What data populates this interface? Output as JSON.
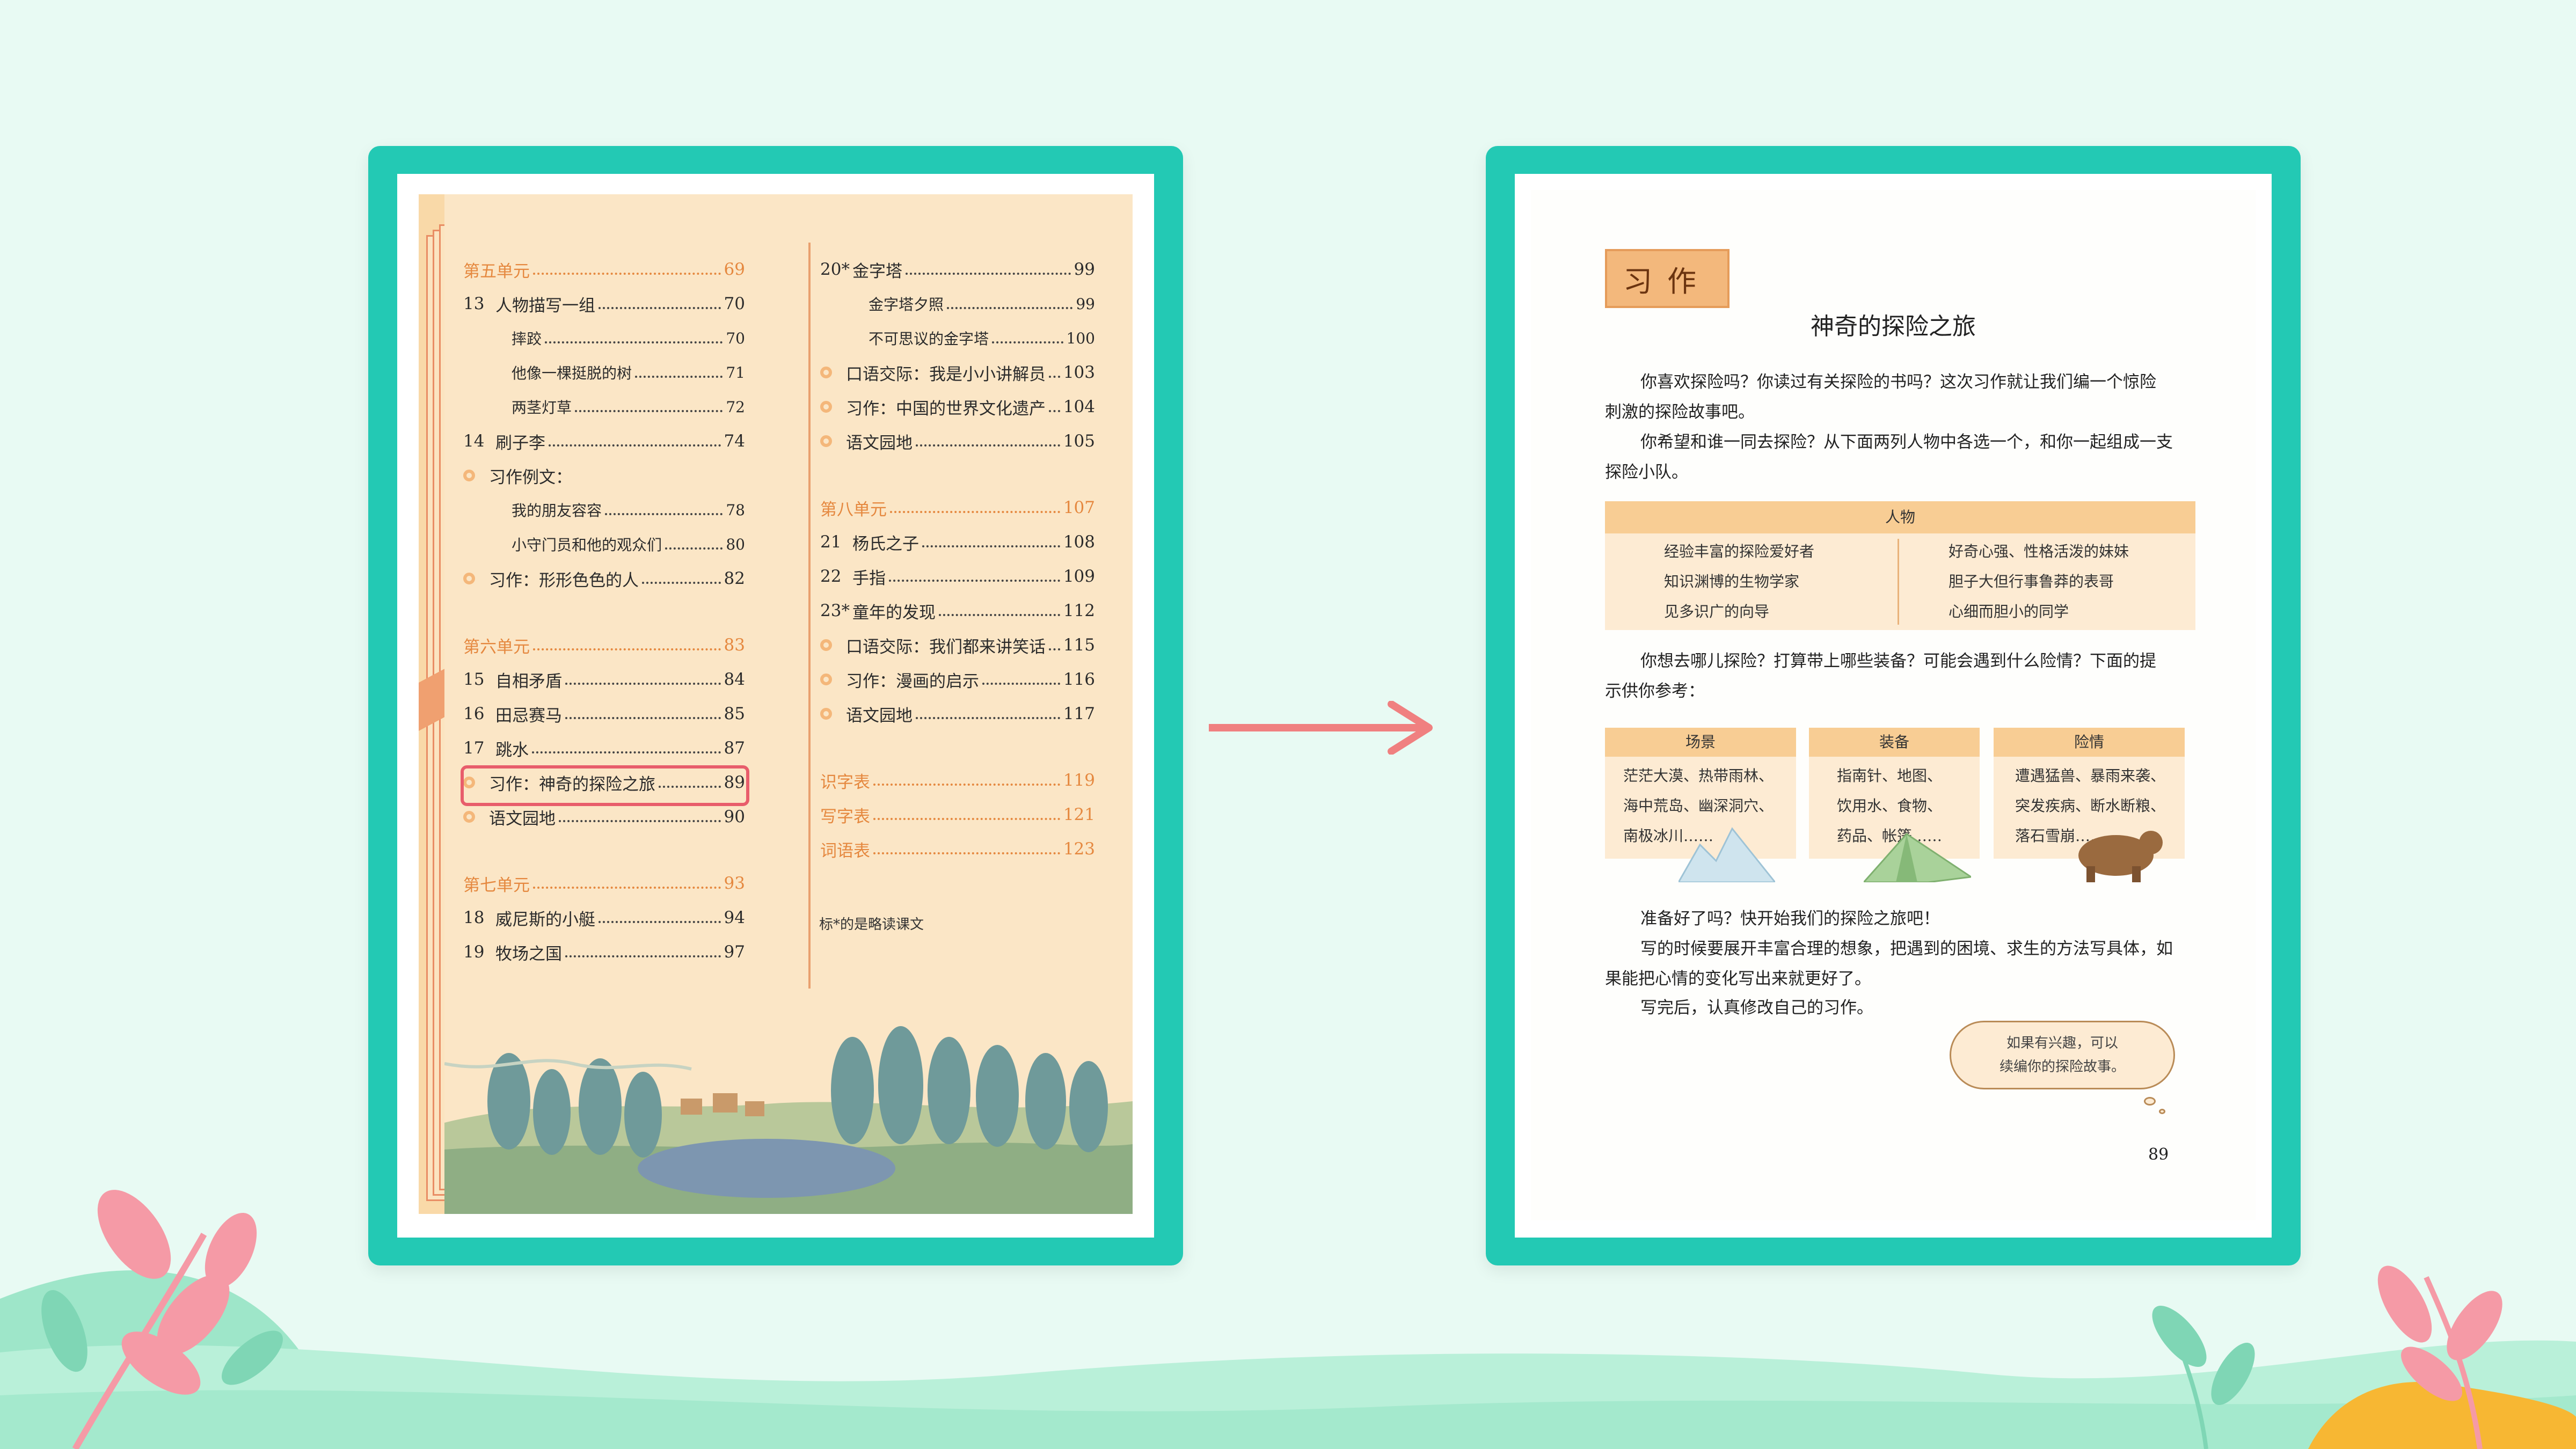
{
  "colors": {
    "background": "#e8faf3",
    "frame": "#23c9b4",
    "highlight": "#e85d6b",
    "arrow": "#f08080",
    "unit_text": "#e5883f"
  },
  "toc": {
    "left": [
      {
        "type": "unit",
        "num": "",
        "label": "第五单元",
        "page": "69"
      },
      {
        "type": "lesson",
        "num": "13",
        "label": "人物描写一组",
        "page": "70"
      },
      {
        "type": "sub",
        "num": "",
        "label": "摔跤",
        "page": "70"
      },
      {
        "type": "sub",
        "num": "",
        "label": "他像一棵挺脱的树",
        "page": "71"
      },
      {
        "type": "sub",
        "num": "",
        "label": "两茎灯草",
        "page": "72"
      },
      {
        "type": "lesson",
        "num": "14",
        "label": "刷子李",
        "page": "74"
      },
      {
        "type": "bullet",
        "num": "",
        "label": "习作例文：",
        "page": ""
      },
      {
        "type": "sub",
        "num": "",
        "label": "我的朋友容容",
        "page": "78"
      },
      {
        "type": "sub",
        "num": "",
        "label": "小守门员和他的观众们",
        "page": "80"
      },
      {
        "type": "bullet",
        "num": "",
        "label": "习作：形形色色的人",
        "page": "82"
      },
      {
        "type": "gap"
      },
      {
        "type": "unit",
        "num": "",
        "label": "第六单元",
        "page": "83"
      },
      {
        "type": "lesson",
        "num": "15",
        "label": "自相矛盾",
        "page": "84"
      },
      {
        "type": "lesson",
        "num": "16",
        "label": "田忌赛马",
        "page": "85"
      },
      {
        "type": "lesson",
        "num": "17",
        "label": "跳水",
        "page": "87"
      },
      {
        "type": "bullet",
        "num": "",
        "label": "习作：神奇的探险之旅",
        "page": "89"
      },
      {
        "type": "bullet",
        "num": "",
        "label": "语文园地",
        "page": "90"
      },
      {
        "type": "gap"
      },
      {
        "type": "unit",
        "num": "",
        "label": "第七单元",
        "page": "93"
      },
      {
        "type": "lesson",
        "num": "18",
        "label": "威尼斯的小艇",
        "page": "94"
      },
      {
        "type": "lesson",
        "num": "19",
        "label": "牧场之国",
        "page": "97"
      }
    ],
    "right": [
      {
        "type": "lesson",
        "num": "20*",
        "label": "金字塔",
        "page": "99"
      },
      {
        "type": "sub",
        "num": "",
        "label": "金字塔夕照",
        "page": "99"
      },
      {
        "type": "sub",
        "num": "",
        "label": "不可思议的金字塔",
        "page": "100"
      },
      {
        "type": "bullet",
        "num": "",
        "label": "口语交际：我是小小讲解员",
        "page": "103"
      },
      {
        "type": "bullet",
        "num": "",
        "label": "习作：中国的世界文化遗产",
        "page": "104"
      },
      {
        "type": "bullet",
        "num": "",
        "label": "语文园地",
        "page": "105"
      },
      {
        "type": "gap"
      },
      {
        "type": "unit",
        "num": "",
        "label": "第八单元",
        "page": "107"
      },
      {
        "type": "lesson",
        "num": "21",
        "label": "杨氏之子",
        "page": "108"
      },
      {
        "type": "lesson",
        "num": "22",
        "label": "手指",
        "page": "109"
      },
      {
        "type": "lesson",
        "num": "23*",
        "label": "童年的发现",
        "page": "112"
      },
      {
        "type": "bullet",
        "num": "",
        "label": "口语交际：我们都来讲笑话",
        "page": "115"
      },
      {
        "type": "bullet",
        "num": "",
        "label": "习作：漫画的启示",
        "page": "116"
      },
      {
        "type": "bullet",
        "num": "",
        "label": "语文园地",
        "page": "117"
      },
      {
        "type": "gap"
      },
      {
        "type": "unit",
        "num": "",
        "label": "识字表",
        "page": "119"
      },
      {
        "type": "unit",
        "num": "",
        "label": "写字表",
        "page": "121"
      },
      {
        "type": "unit",
        "num": "",
        "label": "词语表",
        "page": "123"
      }
    ],
    "note": "标*的是略读课文"
  },
  "article": {
    "badge": "习作",
    "title": "神奇的探险之旅",
    "p1_l1": "你喜欢探险吗？你读过有关探险的书吗？这次习作就让我们编一个惊险",
    "p1_l2": "刺激的探险故事吧。",
    "p2_l1": "你希望和谁一同去探险？从下面两列人物中各选一个，和你一起组成一支",
    "p2_l2": "探险小队。",
    "people_header": "人物",
    "people_left": [
      "经验丰富的探险爱好者",
      "知识渊博的生物学家",
      "见多识广的向导"
    ],
    "people_right": [
      "好奇心强、性格活泼的妹妹",
      "胆子大但行事鲁莽的表哥",
      "心细而胆小的同学"
    ],
    "p3_l1": "你想去哪儿探险？打算带上哪些装备？可能会遇到什么险情？下面的提",
    "p3_l2": "示供你参考：",
    "scene_header": "场景",
    "scene_items": [
      "茫茫大漠、热带雨林、",
      "海中荒岛、幽深洞穴、",
      "南极冰川……"
    ],
    "equip_header": "装备",
    "equip_items": [
      "指南针、地图、",
      "饮用水、食物、",
      "药品、帐篷……"
    ],
    "danger_header": "险情",
    "danger_items": [
      "遭遇猛兽、暴雨来袭、",
      "突发疾病、断水断粮、",
      "落石雪崩……"
    ],
    "p4": "准备好了吗？快开始我们的探险之旅吧！",
    "p5_l1": "写的时候要展开丰富合理的想象，把遇到的困境、求生的方法写具体，如",
    "p5_l2": "果能把心情的变化写出来就更好了。",
    "p6": "写完后，认真修改自己的习作。",
    "bubble_l1": "如果有兴趣，可以",
    "bubble_l2": "续编你的探险故事。",
    "page_number": "89"
  }
}
